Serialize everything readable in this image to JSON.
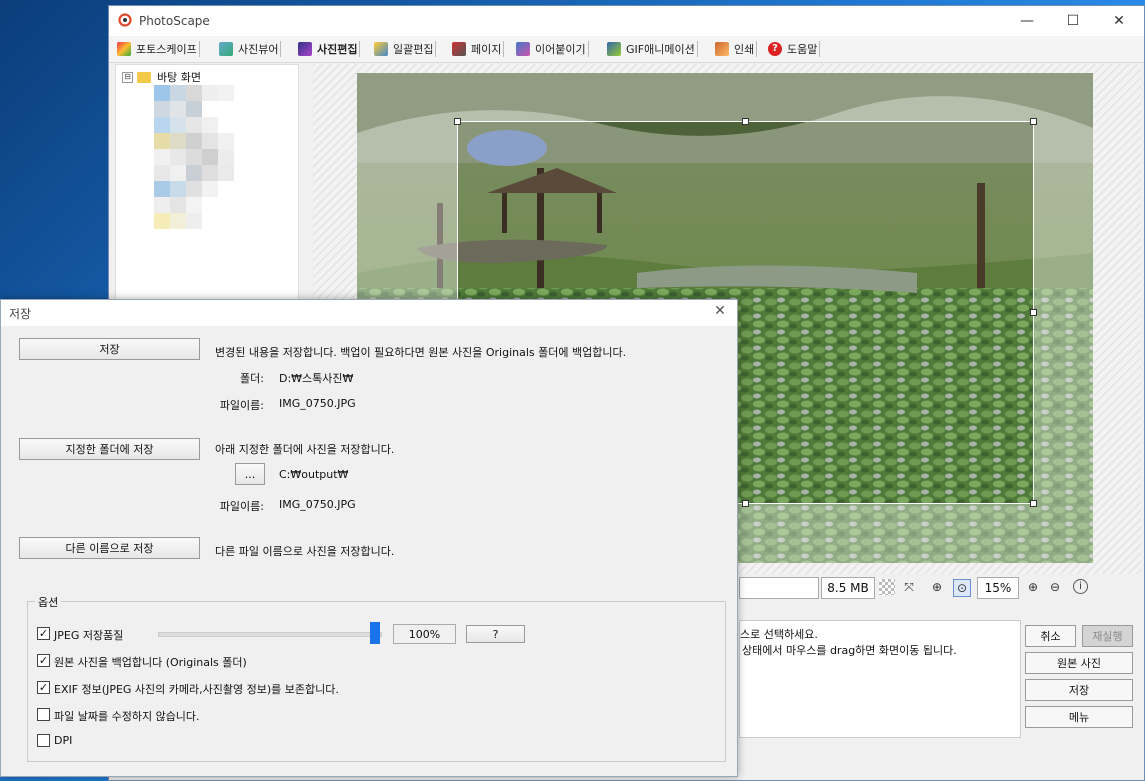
{
  "app": {
    "title": "PhotoScape"
  },
  "tabs": [
    {
      "label": "포토스케이프"
    },
    {
      "label": "사진뷰어"
    },
    {
      "label": "사진편집"
    },
    {
      "label": "일괄편집"
    },
    {
      "label": "페이지"
    },
    {
      "label": "이어붙이기"
    },
    {
      "label": "GIF애니메이션"
    },
    {
      "label": "인쇄"
    },
    {
      "label": "도움말"
    }
  ],
  "tree": {
    "root_label": "바탕 화면",
    "expander": "⊟"
  },
  "status": {
    "filesize": "8.5 MB",
    "zoom": "15%"
  },
  "info": {
    "line1": "스로 선택하세요.",
    "line2": "상태에서 마우스를 drag하면 화면이동 됩니다."
  },
  "right_buttons": {
    "cancel": "취소",
    "redo": "재실행",
    "original": "원본 사진",
    "save": "저장",
    "menu": "메뉴"
  },
  "dialog": {
    "title": "저장",
    "save_btn": "저장",
    "save_desc": "변경된 내용을 저장합니다. 백업이 필요하다면 원본 사진을 Originals 폴더에 백업합니다.",
    "folder_label": "폴더:",
    "folder_value": "D:₩스톡사진₩",
    "filename_label": "파일이름:",
    "filename_value": "IMG_0750.JPG",
    "save_folder_btn": "지정한 폴더에 저장",
    "save_folder_desc": "아래 지정한 폴더에 사진을 저장합니다.",
    "browse_btn": "...",
    "output_value": "C:₩output₩",
    "filename2_label": "파일이름:",
    "filename2_value": "IMG_0750.JPG",
    "save_as_btn": "다른 이름으로 저장",
    "save_as_desc": "다른 파일 이름으로 사진을 저장합니다.",
    "options_title": "옵션",
    "jpeg_label": "JPEG 저장품질",
    "jpeg_quality": 100,
    "jpeg_value": "100%",
    "help_btn": "?",
    "backup_label": "원본 사진을 백업합니다 (Originals 폴더)",
    "exif_label": "EXIF 정보(JPEG 사진의 카메라,사진촬영 정보)를 보존합니다.",
    "nodate_label": "파일 날짜를 수정하지 않습니다.",
    "dpi_label": "DPI",
    "checks": {
      "jpeg": true,
      "backup": true,
      "exif": true,
      "nodate": false,
      "dpi": false
    }
  }
}
